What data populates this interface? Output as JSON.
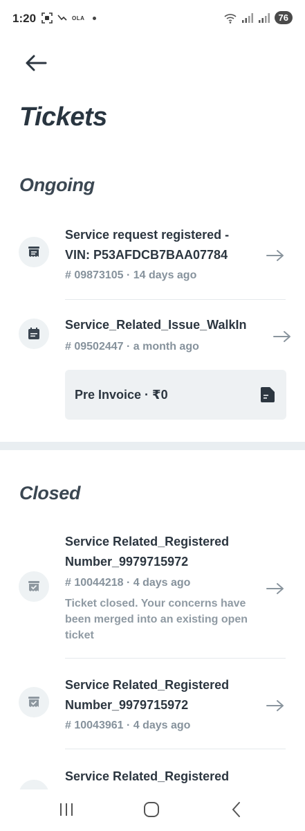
{
  "status_bar": {
    "time": "1:20",
    "carrier_badge": "OLA",
    "battery": "76"
  },
  "header": {
    "title": "Tickets"
  },
  "ongoing": {
    "title": "Ongoing",
    "tickets": [
      {
        "title": "Service request registered - VIN: P53AFDCB7BAA07784",
        "meta": "# 09873105 · 14 days ago"
      },
      {
        "title": "Service_Related_Issue_WalkIn",
        "meta": "# 09502447 · a month ago"
      }
    ],
    "invoice": {
      "label": "Pre Invoice · ₹0"
    }
  },
  "closed": {
    "title": "Closed",
    "tickets": [
      {
        "title": "Service Related_Registered Number_9979715972",
        "meta": "# 10044218 · 4 days ago",
        "note": "Ticket closed. Your concerns have been merged into an existing open ticket"
      },
      {
        "title": "Service Related_Registered Number_9979715972",
        "meta": "# 10043961 · 4 days ago"
      },
      {
        "title": "Service Related_Registered"
      }
    ]
  },
  "colors": {
    "heading": "#293540",
    "meta": "#86929c",
    "icon_bg": "#eef2f4",
    "divider": "#e5e9ec"
  }
}
